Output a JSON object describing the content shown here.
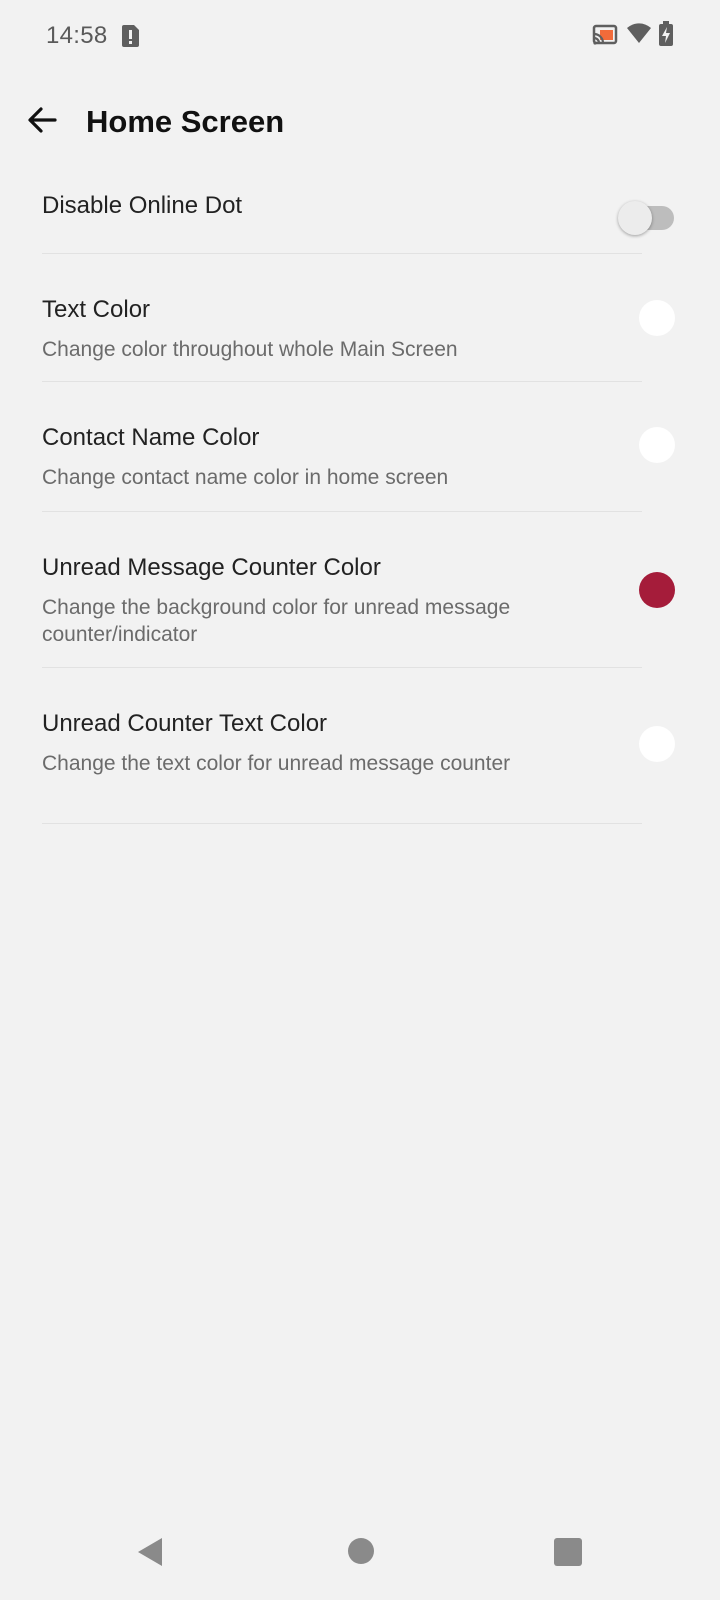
{
  "status_bar": {
    "time": "14:58",
    "icons": [
      "sim-alert-icon",
      "cast-icon",
      "wifi-icon",
      "battery-charging-icon"
    ],
    "cast_accent": "#f26b3a"
  },
  "app_bar": {
    "title": "Home Screen",
    "back_icon": "arrow-back-icon"
  },
  "settings": [
    {
      "title": "Disable Online Dot",
      "summary": "",
      "control": "toggle",
      "checked": false
    },
    {
      "title": "Text Color",
      "summary": "Change color throughout whole Main Screen",
      "control": "color",
      "color": "#ffffff"
    },
    {
      "title": "Contact Name Color",
      "summary": "Change contact name color in home screen",
      "control": "color",
      "color": "#ffffff"
    },
    {
      "title": "Unread Message Counter Color",
      "summary": "Change the background color for unread message counter/indicator",
      "control": "color",
      "color": "#a51c3a"
    },
    {
      "title": "Unread Counter Text Color",
      "summary": "Change the text color for unread message counter",
      "control": "color",
      "color": "#ffffff"
    }
  ],
  "nav_bar": {
    "icons": [
      "nav-back-icon",
      "nav-home-icon",
      "nav-recents-icon"
    ]
  }
}
